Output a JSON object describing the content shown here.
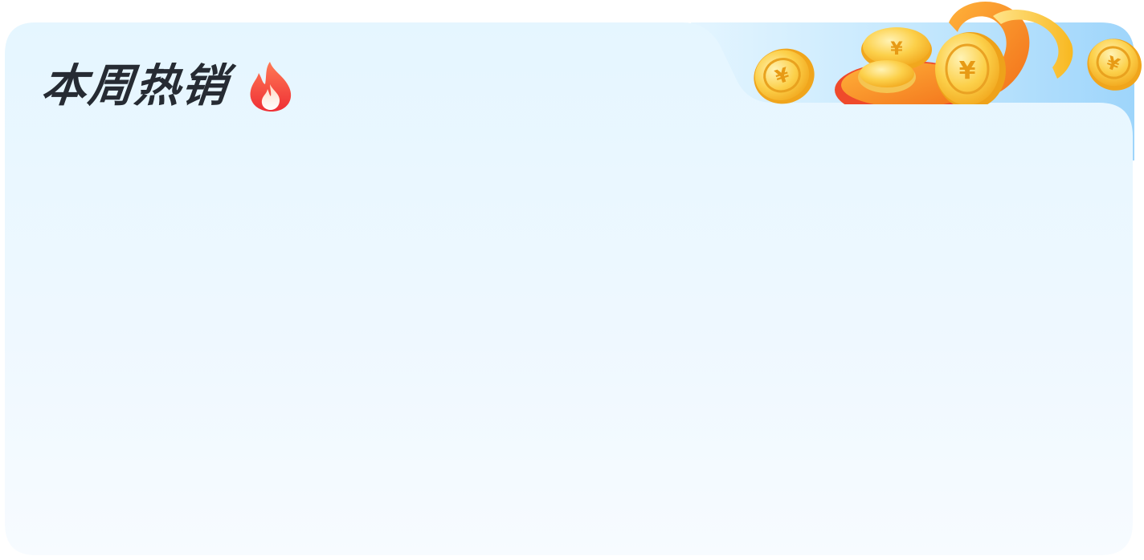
{
  "section": {
    "title": "本周热销",
    "title_icon": "fire-icon",
    "decoration_icon": "gold-coins-icon"
  },
  "colors": {
    "panel_top": "#e6f6ff",
    "panel_bottom": "#f6fbff",
    "tab_blue": "#9fd6fb",
    "title_text": "#262b33",
    "flame_red": "#f23b3b",
    "flame_orange": "#ff8b5a",
    "coin_gold": "#fbc73a",
    "coin_light": "#ffe79a",
    "coin_orange": "#f39a1c"
  }
}
